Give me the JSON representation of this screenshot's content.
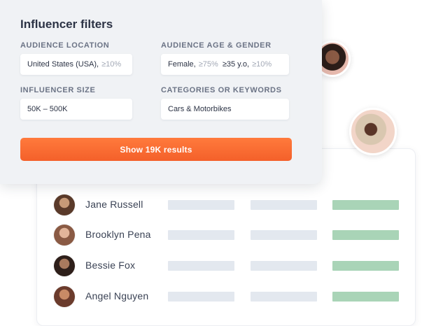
{
  "filters": {
    "title": "Influencer filters",
    "audience_location": {
      "label": "AUDIENCE LOCATION",
      "value": "United States (USA),",
      "threshold": "≥10%"
    },
    "audience_age_gender": {
      "label": "AUDIENCE AGE & GENDER",
      "gender": "Female,",
      "gender_threshold": "≥75%",
      "age": "≥35 y.o,",
      "age_threshold": "≥10%"
    },
    "influencer_size": {
      "label": "INFLUENCER SIZE",
      "value": "50K – 500K"
    },
    "categories": {
      "label": "CATEGORIES OR KEYWORDS",
      "value": "Cars & Motorbikes"
    },
    "cta_label": "Show 19K results"
  },
  "results": [
    {
      "name": "Jane Russell"
    },
    {
      "name": "Brooklyn Pena"
    },
    {
      "name": "Bessie Fox"
    },
    {
      "name": "Angel Nguyen"
    }
  ],
  "colors": {
    "accent": "#f4602a",
    "panel_bg": "#f0f2f5",
    "bar_grey": "#e3e8ef",
    "bar_green": "#a9d4b7"
  }
}
